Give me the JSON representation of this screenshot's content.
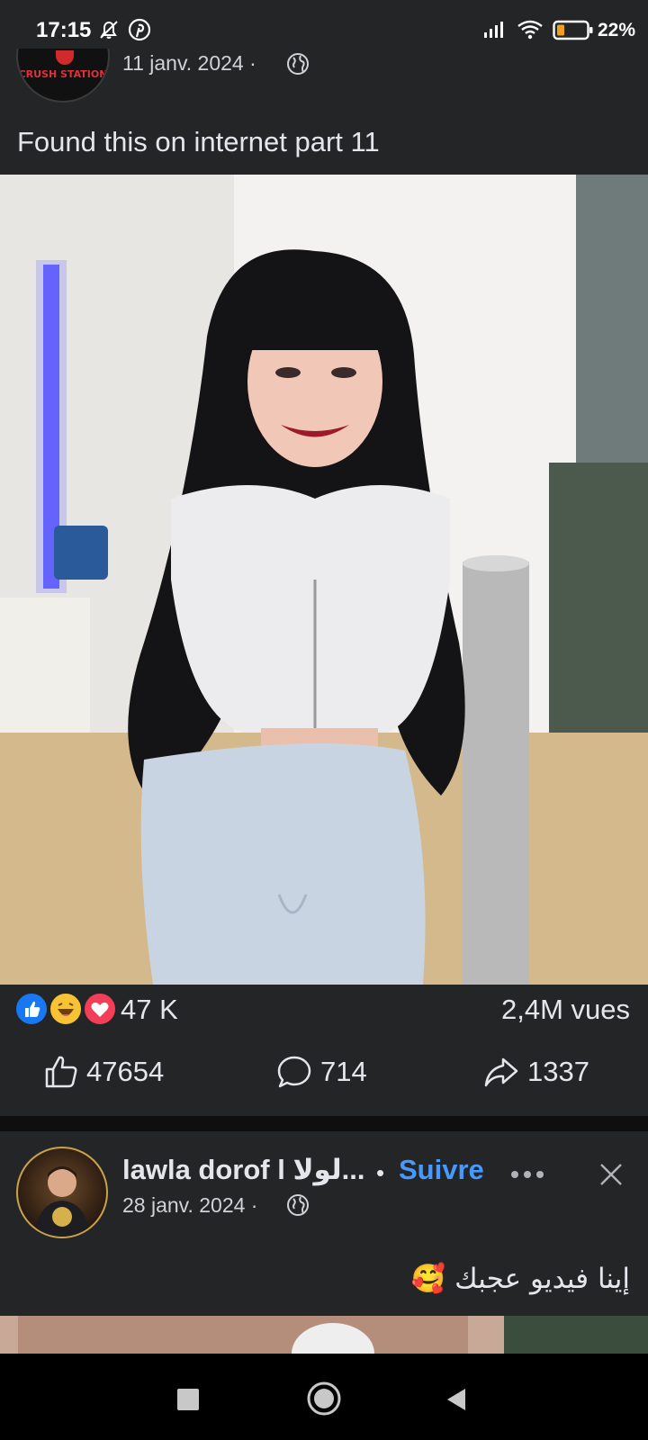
{
  "status_bar": {
    "time": "17:15",
    "battery": "22%",
    "icons": [
      "bell-off-icon",
      "pinterest-icon",
      "signal-icon",
      "wifi-icon",
      "battery-icon"
    ]
  },
  "post1": {
    "page_avatar_text": "CRUSH STATION",
    "date": "11 janv. 2024 ·",
    "audience_icon": "globe-icon",
    "text": "Found this on internet part 11",
    "media": "video",
    "reaction_icons": [
      "like-reaction-icon",
      "haha-reaction-icon",
      "love-reaction-icon"
    ],
    "reaction_count": "47 K",
    "views": "2,4M vues",
    "likes": "47654",
    "comments": "714",
    "shares": "1337"
  },
  "post2": {
    "author": "lawla dorof l لولا...",
    "follow_separator": "•",
    "follow_label": "Suivre",
    "date": "28 janv. 2024 ·",
    "audience_icon": "globe-icon",
    "text": "إينا فيديو عجبك 🥰"
  },
  "colors": {
    "background": "#242527",
    "accent": "#4599ff",
    "text": "#e4e6eb",
    "divider": "#0f0f10"
  }
}
